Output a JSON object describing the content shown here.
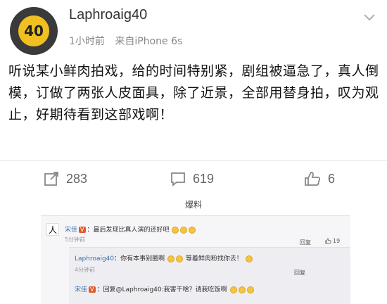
{
  "post": {
    "username": "Laphroaig40",
    "avatar_text": "40",
    "time": "1小时前",
    "source": "来自iPhone 6s",
    "content": "听说某小鲜肉拍戏，给的时间特别紧，剧组被逼急了，真人倒模，订做了两张人皮面具，除了近景，全部用替身拍，叹为观止，好期待看到这部戏啊！"
  },
  "actions": {
    "repost_count": "283",
    "comment_count": "619",
    "like_count": "6"
  },
  "embed": {
    "label": "爆料",
    "comments": [
      {
        "name": "宋佳",
        "badge": "V",
        "text": "：最后发现比真人演的还好吧",
        "time": "5分钟前",
        "reply_label": "回复",
        "like_count": "19"
      },
      {
        "name": "Laphroaig40",
        "text": "：你有本事别圈啊",
        "text2": "等着鲜肉粉找你去！",
        "time": "4分钟前",
        "reply_label": "回复"
      },
      {
        "name": "宋佳",
        "badge": "V",
        "text": "：回复@Laphroaig40:我害干啥？请我吃饭啊"
      }
    ]
  },
  "icons": {
    "avatar": "avatar-icon",
    "dropdown": "chevron-down-icon",
    "repost": "repost-icon",
    "comment": "comment-icon",
    "like": "thumbs-up-icon"
  }
}
